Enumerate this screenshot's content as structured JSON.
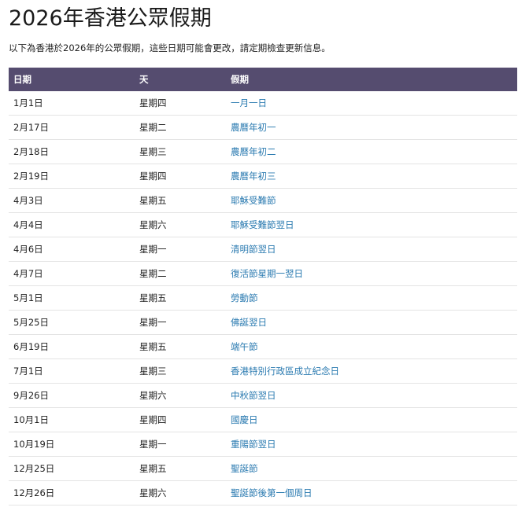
{
  "page": {
    "title": "2026年香港公眾假期",
    "subtitle": "以下為香港於2026年的公眾假期，這些日期可能會更改，請定期檢查更新信息。"
  },
  "colors": {
    "header_bg": "#554c6f",
    "header_text": "#ffffff",
    "link": "#2a7ab0",
    "row_border": "#e4e4e4"
  },
  "table": {
    "headers": [
      "日期",
      "天",
      "假期"
    ],
    "rows": [
      {
        "date": "1月1日",
        "day": "星期四",
        "holiday": "一月一日"
      },
      {
        "date": "2月17日",
        "day": "星期二",
        "holiday": "農曆年初一"
      },
      {
        "date": "2月18日",
        "day": "星期三",
        "holiday": "農曆年初二"
      },
      {
        "date": "2月19日",
        "day": "星期四",
        "holiday": "農曆年初三"
      },
      {
        "date": "4月3日",
        "day": "星期五",
        "holiday": "耶穌受難節"
      },
      {
        "date": "4月4日",
        "day": "星期六",
        "holiday": "耶穌受難節翌日"
      },
      {
        "date": "4月6日",
        "day": "星期一",
        "holiday": "清明節翌日"
      },
      {
        "date": "4月7日",
        "day": "星期二",
        "holiday": "復活節星期一翌日"
      },
      {
        "date": "5月1日",
        "day": "星期五",
        "holiday": "勞動節"
      },
      {
        "date": "5月25日",
        "day": "星期一",
        "holiday": "佛誕翌日"
      },
      {
        "date": "6月19日",
        "day": "星期五",
        "holiday": "端午節"
      },
      {
        "date": "7月1日",
        "day": "星期三",
        "holiday": "香港特別行政區成立紀念日"
      },
      {
        "date": "9月26日",
        "day": "星期六",
        "holiday": "中秋節翌日"
      },
      {
        "date": "10月1日",
        "day": "星期四",
        "holiday": "國慶日"
      },
      {
        "date": "10月19日",
        "day": "星期一",
        "holiday": "重陽節翌日"
      },
      {
        "date": "12月25日",
        "day": "星期五",
        "holiday": "聖誕節"
      },
      {
        "date": "12月26日",
        "day": "星期六",
        "holiday": "聖誕節後第一個周日"
      }
    ]
  }
}
